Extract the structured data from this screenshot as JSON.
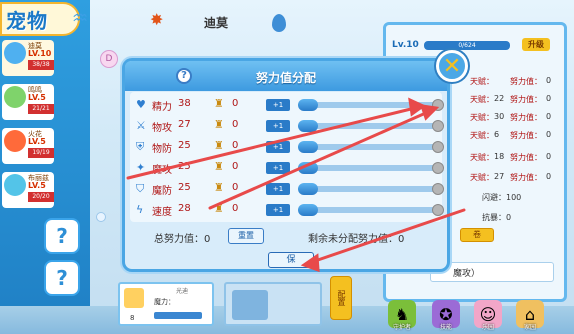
{
  "title": "宠物",
  "pet_name": "迪莫",
  "pets": [
    {
      "name": "迪莫",
      "level": "LV.10",
      "hp": "38/38",
      "color": "#4fb0f0"
    },
    {
      "name": "鸣鸣",
      "level": "LV.5",
      "hp": "21/21",
      "color": "#7fd36b"
    },
    {
      "name": "火花",
      "level": "LV.5",
      "hp": "19/19",
      "color": "#ff6a3a"
    },
    {
      "name": "布丽兹",
      "level": "LV.5",
      "hp": "20/20",
      "color": "#53c4e8"
    }
  ],
  "modal": {
    "title": "努力值分配",
    "stats": [
      {
        "label": "精力",
        "value": "38",
        "effort": "0",
        "icon": "heart-icon"
      },
      {
        "label": "物攻",
        "value": "27",
        "effort": "0",
        "icon": "sword-icon"
      },
      {
        "label": "物防",
        "value": "25",
        "effort": "0",
        "icon": "shield-icon"
      },
      {
        "label": "魔攻",
        "value": "25",
        "effort": "0",
        "icon": "magic-icon"
      },
      {
        "label": "魔防",
        "value": "25",
        "effort": "0",
        "icon": "magic-shield-icon"
      },
      {
        "label": "速度",
        "value": "28",
        "effort": "0",
        "icon": "lightning-icon"
      }
    ],
    "plus_label": "+1",
    "total_label": "总努力值：",
    "total_value": "0",
    "reset_label": "重置",
    "remain_label": "剩余未分配努力值：",
    "remain_value": "0",
    "save_label": "保"
  },
  "right_panel": {
    "level": "Lv.10",
    "exp": "0/624",
    "upgrade_label": "升级",
    "rows": [
      {
        "tianfu": "天赋：",
        "tianfu_val": "",
        "effort": "努力值：",
        "effort_val": "0"
      },
      {
        "tianfu": "天赋：",
        "tianfu_val": "22",
        "effort": "努力值：",
        "effort_val": "0"
      },
      {
        "tianfu": "天赋：",
        "tianfu_val": "30",
        "effort": "努力值：",
        "effort_val": "0"
      },
      {
        "tianfu": "天赋：",
        "tianfu_val": "6",
        "effort": "努力值：",
        "effort_val": "0"
      },
      {
        "tianfu": "天赋：",
        "tianfu_val": "18",
        "effort": "努力值：",
        "effort_val": "0"
      },
      {
        "tianfu": "天赋：",
        "tianfu_val": "27",
        "effort": "努力值：",
        "effort_val": "0"
      }
    ],
    "dodge": "闪避：100",
    "resist": "抗暴：0",
    "coupon": "卷",
    "bottom_text": "魔攻）"
  },
  "bottom_pet": {
    "level": "8",
    "stat": "魔力：",
    "name": "光迪"
  },
  "alloc_side_label": "配置",
  "bottom_icons": [
    {
      "label": "守护者",
      "icon": "guardian-icon"
    },
    {
      "label": "技能",
      "icon": "skill-icon"
    },
    {
      "label": "乐园",
      "icon": "park-icon"
    },
    {
      "label": "家园",
      "icon": "home-icon"
    }
  ],
  "colors": {
    "accent": "#3d9ae0",
    "arrow": "#e84a4a",
    "label_red": "#b01818"
  }
}
